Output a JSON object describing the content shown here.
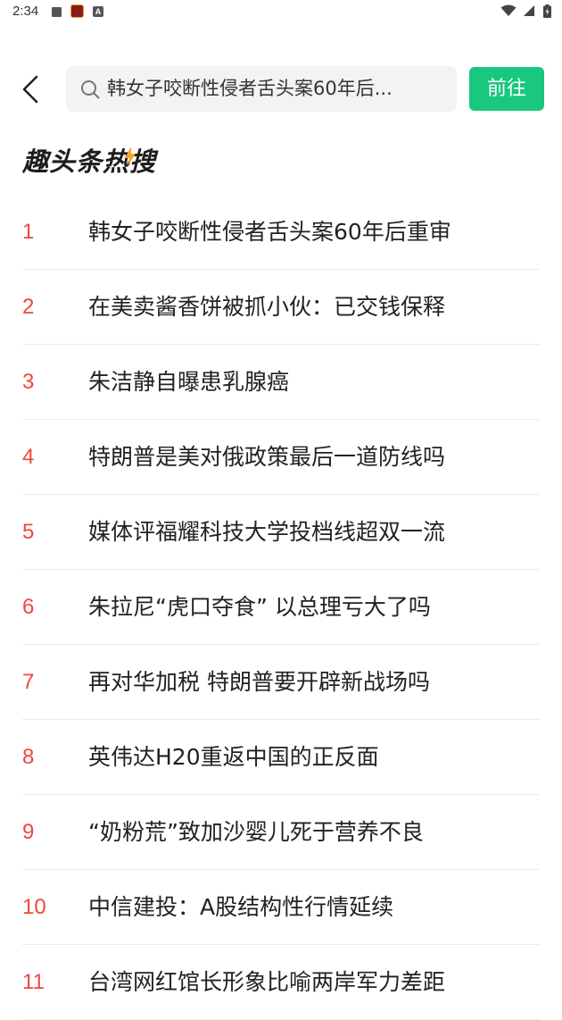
{
  "status_bar": {
    "time": "2:34",
    "icons": [
      "stop-icon",
      "app-notification-icon",
      "accessibility-a-icon",
      "wifi-icon",
      "signal-icon",
      "battery-icon"
    ]
  },
  "header": {
    "back_icon": "chevron-left-icon",
    "search_icon": "search-icon",
    "search_text": "韩女子咬断性侵者舌头案60年后...",
    "go_label": "前往"
  },
  "section": {
    "title": "趣头条热搜"
  },
  "colors": {
    "accent_green": "#19c77f",
    "rank_red": "#f0463f"
  },
  "hot_list": [
    {
      "rank": "1",
      "title": "韩女子咬断性侵者舌头案60年后重审"
    },
    {
      "rank": "2",
      "title": "在美卖酱香饼被抓小伙：已交钱保释"
    },
    {
      "rank": "3",
      "title": "朱洁静自曝患乳腺癌"
    },
    {
      "rank": "4",
      "title": "特朗普是美对俄政策最后一道防线吗"
    },
    {
      "rank": "5",
      "title": "媒体评福耀科技大学投档线超双一流"
    },
    {
      "rank": "6",
      "title": "朱拉尼“虎口夺食” 以总理亏大了吗"
    },
    {
      "rank": "7",
      "title": "再对华加税 特朗普要开辟新战场吗"
    },
    {
      "rank": "8",
      "title": "英伟达H20重返中国的正反面"
    },
    {
      "rank": "9",
      "title": "“奶粉荒”致加沙婴儿死于营养不良"
    },
    {
      "rank": "10",
      "title": "中信建投：A股结构性行情延续"
    },
    {
      "rank": "11",
      "title": "台湾网红馆长形象比喻两岸军力差距"
    }
  ]
}
